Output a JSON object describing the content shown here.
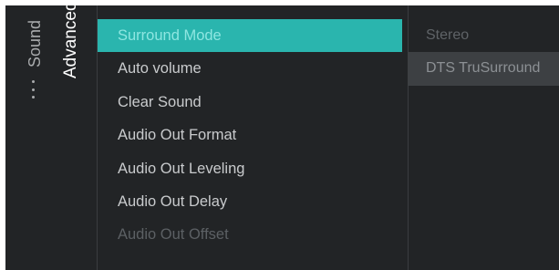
{
  "breadcrumb": {
    "parent": "Sound",
    "current": "Advanced"
  },
  "menu": {
    "items": [
      {
        "label": "Surround Mode",
        "state": "selected"
      },
      {
        "label": "Auto volume",
        "state": "normal"
      },
      {
        "label": "Clear Sound",
        "state": "normal"
      },
      {
        "label": "Audio Out Format",
        "state": "normal"
      },
      {
        "label": "Audio Out Leveling",
        "state": "normal"
      },
      {
        "label": "Audio Out Delay",
        "state": "normal"
      },
      {
        "label": "Audio Out Offset",
        "state": "disabled"
      }
    ]
  },
  "options": {
    "items": [
      {
        "label": "Stereo",
        "state": "normal"
      },
      {
        "label": "DTS TruSurround",
        "state": "highlighted"
      }
    ]
  },
  "colors": {
    "background": "#222426",
    "accent": "#2ab5ae"
  }
}
